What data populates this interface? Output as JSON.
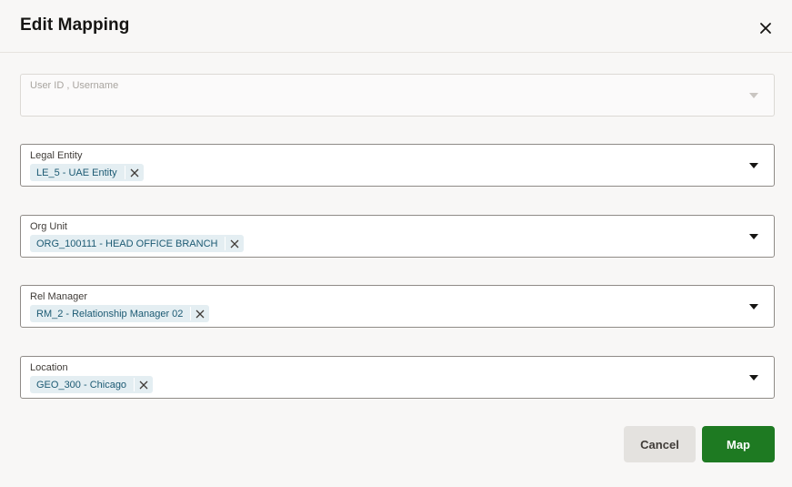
{
  "dialog": {
    "title": "Edit Mapping"
  },
  "fields": {
    "user": {
      "label": "User ID , Username",
      "value": ""
    },
    "legal_entity": {
      "label": "Legal Entity",
      "chip": "LE_5 - UAE Entity"
    },
    "org_unit": {
      "label": "Org Unit",
      "chip": "ORG_100111 - HEAD OFFICE BRANCH"
    },
    "rel_manager": {
      "label": "Rel Manager",
      "chip": "RM_2 - Relationship Manager 02"
    },
    "location": {
      "label": "Location",
      "chip": "GEO_300 - Chicago"
    }
  },
  "footer": {
    "cancel_label": "Cancel",
    "map_label": "Map"
  },
  "colors": {
    "primary_button": "#1e7a22",
    "chip_background": "#e4eef2",
    "chip_text": "#1c5a73"
  },
  "icons": {
    "close": "close-icon",
    "dropdown": "chevron-down-icon",
    "chip_remove": "close-icon"
  }
}
